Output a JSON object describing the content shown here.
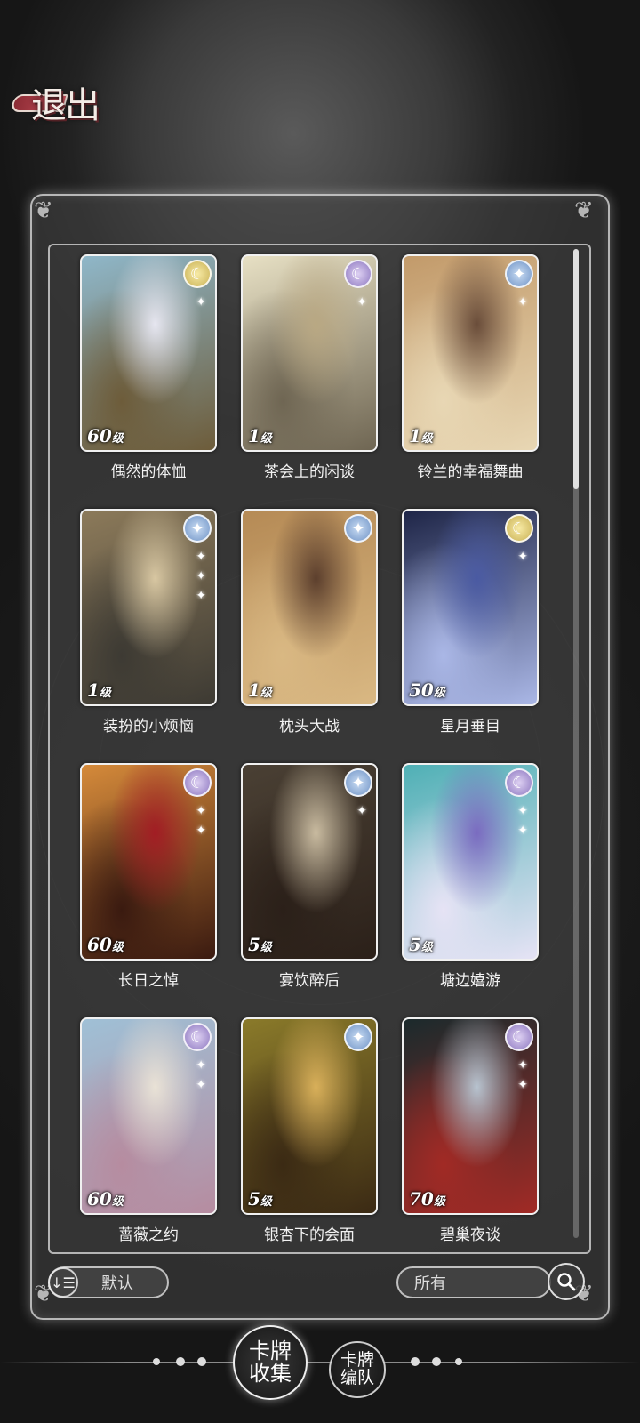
{
  "header": {
    "exit_label": "退出"
  },
  "cards": [
    {
      "name": "偶然的体恤",
      "level_num": "60",
      "level_unit": "级",
      "badge": "sun",
      "badge_icon": "moon-sun-icon",
      "sparkles": 1,
      "art": [
        "#8fb7c9",
        "#e6e6f0",
        "#6d5c3a"
      ]
    },
    {
      "name": "茶会上的闲谈",
      "level_num": "1",
      "level_unit": "级",
      "badge": "purple",
      "badge_icon": "moon-icon",
      "sparkles": 1,
      "art": [
        "#e7e0c4",
        "#b9a883",
        "#6f6653"
      ]
    },
    {
      "name": "铃兰的幸福舞曲",
      "level_num": "1",
      "level_unit": "级",
      "badge": "blue",
      "badge_icon": "star-moon-icon",
      "sparkles": 1,
      "art": [
        "#c29a6a",
        "#6a4d3a",
        "#e8d7b4"
      ]
    },
    {
      "name": "装扮的小烦恼",
      "level_num": "1",
      "level_unit": "级",
      "badge": "blue",
      "badge_icon": "star-moon-icon",
      "sparkles": 3,
      "art": [
        "#8c7a5a",
        "#d8c7a2",
        "#3d3a33"
      ]
    },
    {
      "name": "枕头大战",
      "level_num": "1",
      "level_unit": "级",
      "badge": "blue",
      "badge_icon": "star-moon-icon",
      "sparkles": 0,
      "art": [
        "#b58a55",
        "#5c3f2d",
        "#d9b883"
      ]
    },
    {
      "name": "星月垂目",
      "level_num": "50",
      "level_unit": "级",
      "badge": "sun",
      "badge_icon": "moon-sun-icon",
      "sparkles": 1,
      "art": [
        "#1e2547",
        "#4a5aa2",
        "#aab7e6"
      ]
    },
    {
      "name": "长日之悼",
      "level_num": "60",
      "level_unit": "级",
      "badge": "purple",
      "badge_icon": "moon-icon",
      "sparkles": 2,
      "art": [
        "#d58a3a",
        "#a21d24",
        "#3a1a10"
      ]
    },
    {
      "name": "宴饮醉后",
      "level_num": "5",
      "level_unit": "级",
      "badge": "blue",
      "badge_icon": "star-moon-icon",
      "sparkles": 1,
      "art": [
        "#4a4034",
        "#c9bba0",
        "#2b2019"
      ]
    },
    {
      "name": "塘边嬉游",
      "level_num": "5",
      "level_unit": "级",
      "badge": "purple",
      "badge_icon": "moon-icon",
      "sparkles": 2,
      "art": [
        "#4fb0b5",
        "#7a6bc0",
        "#e6e3f5"
      ]
    },
    {
      "name": "蔷薇之约",
      "level_num": "60",
      "level_unit": "级",
      "badge": "purple",
      "badge_icon": "moon-icon",
      "sparkles": 2,
      "art": [
        "#9fc0d6",
        "#e9e2d6",
        "#b68ca0"
      ]
    },
    {
      "name": "银杏下的会面",
      "level_num": "5",
      "level_unit": "级",
      "badge": "blue",
      "badge_icon": "star-moon-icon",
      "sparkles": 0,
      "art": [
        "#8a7a2a",
        "#d9b05a",
        "#3b2a14"
      ]
    },
    {
      "name": "碧巢夜谈",
      "level_num": "70",
      "level_unit": "级",
      "badge": "purple",
      "badge_icon": "moon-icon",
      "sparkles": 2,
      "art": [
        "#1b2a2c",
        "#b7c3cf",
        "#a12a25"
      ]
    }
  ],
  "controls": {
    "sort_label": "默认",
    "filter_label": "所有"
  },
  "nav": {
    "active_tab": "卡牌收集",
    "inactive_tab": "卡牌编队"
  }
}
